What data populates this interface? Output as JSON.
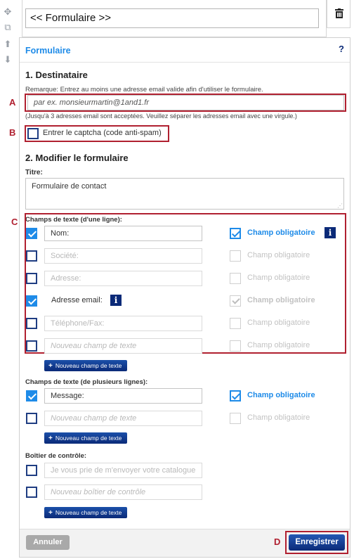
{
  "toolbar": {
    "icons": [
      "move-icon",
      "duplicate-icon",
      "arrow-up-icon",
      "arrow-down-icon"
    ],
    "delete_icon": "trash-icon"
  },
  "element_title": "<< Formulaire >>",
  "panel": {
    "title": "Formulaire",
    "help": "?"
  },
  "section1": {
    "heading": "1. Destinataire",
    "remark": "Remarque: Entrez au moins une adresse email valide afin d'utiliser le formulaire.",
    "email_placeholder": "par ex. monsieurmartin@1and1.fr",
    "hint": "(Jusqu'à 3 adresses email sont acceptées. Veuillez séparer les adresses email avec une virgule.)",
    "captcha_label": "Entrer le captcha (code anti-spam)"
  },
  "section2": {
    "heading": "2. Modifier le formulaire",
    "title_label": "Titre:",
    "title_value": "Formulaire de contact"
  },
  "single_line": {
    "heading": "Champs de texte (d'une ligne):",
    "required_label": "Champ obligatoire",
    "rows": [
      {
        "value": "Nom:"
      },
      {
        "value": "Société:"
      },
      {
        "value": "Adresse:"
      },
      {
        "value": "Adresse email:"
      },
      {
        "value": "Téléphone/Fax:"
      },
      {
        "placeholder": "Nouveau champ de texte"
      }
    ],
    "add_button": "Nouveau champ de texte"
  },
  "multi_line": {
    "heading": "Champs de texte (de plusieurs lignes):",
    "required_label": "Champ obligatoire",
    "rows": [
      {
        "value": "Message:"
      },
      {
        "placeholder": "Nouveau champ de texte"
      }
    ],
    "add_button": "Nouveau champ de texte"
  },
  "checkbox_section": {
    "heading": "Boîtier de contrôle:",
    "rows": [
      {
        "value": "Je vous prie de m'envoyer votre catalogue"
      },
      {
        "placeholder": "Nouveau boîtier de contrôle"
      }
    ],
    "add_button": "Nouveau champ de texte"
  },
  "footer": {
    "cancel": "Annuler",
    "save": "Enregistrer"
  },
  "markers": {
    "a": "A",
    "b": "B",
    "c": "C",
    "d": "D"
  },
  "colors": {
    "accent": "#1e8be8",
    "dark_blue": "#0b2a78",
    "highlight_red": "#b02030"
  }
}
